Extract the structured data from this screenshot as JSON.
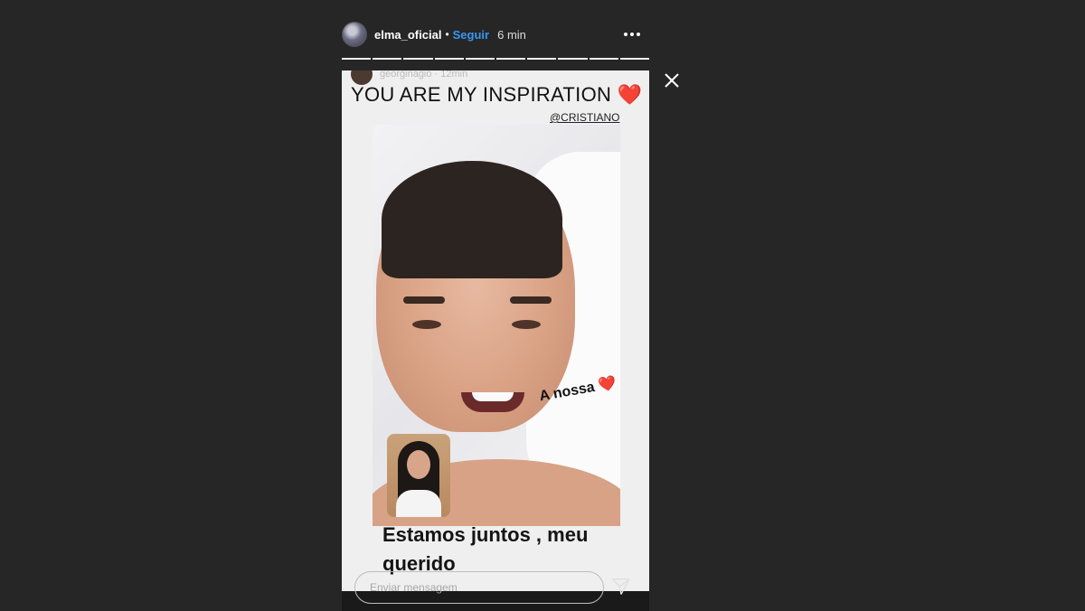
{
  "header": {
    "username": "elma_oficial",
    "separator": "•",
    "follow_label": "Seguir",
    "timestamp": "6 min",
    "more_icon": "more-horizontal-icon"
  },
  "progress": {
    "segments": 10,
    "color": "#f2f2f2"
  },
  "story": {
    "inner_username": "georginagio · 12min",
    "headline": "YOU ARE MY INSPIRATION ❤️",
    "mention": "@CRISTIANO",
    "sticker_text": "A nossa ❤️",
    "caption": "Estamos juntos , meu querido"
  },
  "reply": {
    "placeholder": "Enviar mensagem",
    "send_icon": "send-icon"
  },
  "close_icon": "close-icon",
  "colors": {
    "background": "#262626",
    "accent": "#3897f0"
  }
}
